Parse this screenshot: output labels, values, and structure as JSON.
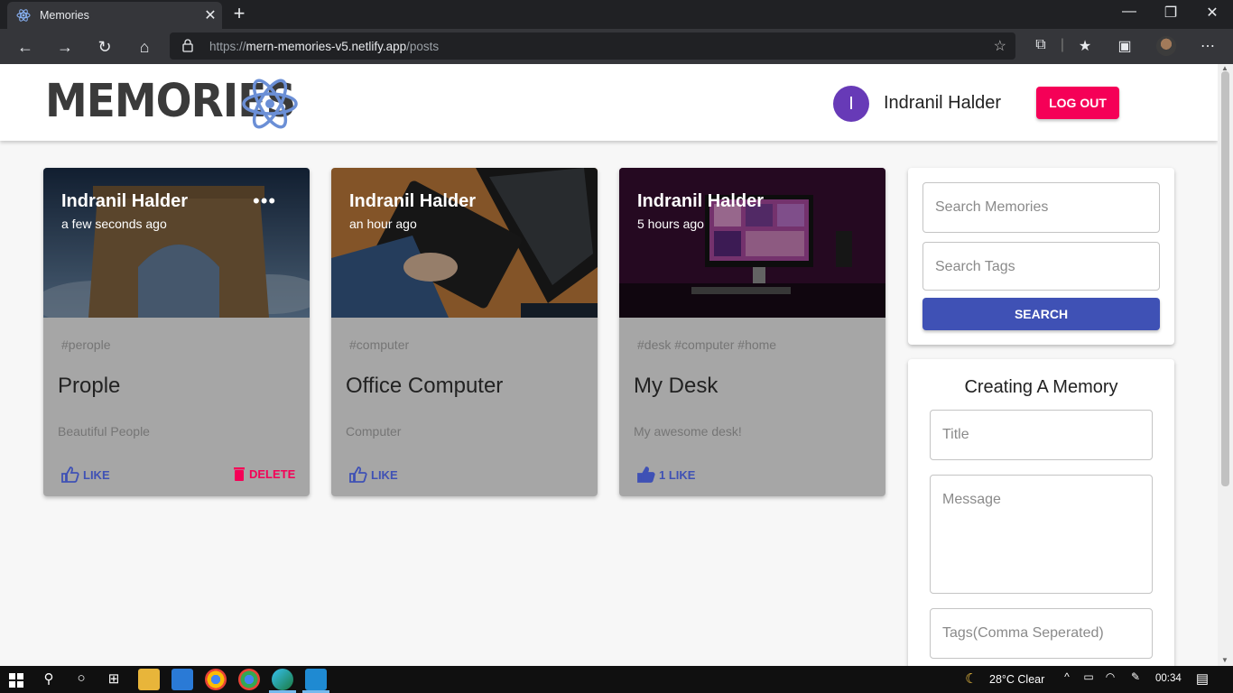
{
  "browser": {
    "tab_title": "Memories",
    "url_prefix": "https://",
    "url_host": "mern-memories-v5.netlify.app",
    "url_path": "/posts"
  },
  "app": {
    "logo_text": "MEMORIES",
    "user_initial": "I",
    "user_name": "Indranil Halder",
    "logout_label": "LOG OUT"
  },
  "posts": [
    {
      "author": "Indranil Halder",
      "time": "a few seconds ago",
      "tags": "#perople",
      "title": "Prople",
      "message": "Beautiful People",
      "like_label": "LIKE",
      "delete_label": "DELETE"
    },
    {
      "author": "Indranil Halder",
      "time": "an hour ago",
      "tags": "#computer",
      "title": "Office Computer",
      "message": "Computer",
      "like_label": "LIKE"
    },
    {
      "author": "Indranil Halder",
      "time": "5 hours ago",
      "tags": "#desk #computer #home",
      "title": "My Desk",
      "message": "My awesome desk!",
      "like_label": "1 LIKE"
    }
  ],
  "search": {
    "memories_placeholder": "Search Memories",
    "tags_placeholder": "Search Tags",
    "button_label": "SEARCH"
  },
  "form": {
    "title": "Creating A Memory",
    "title_placeholder": "Title",
    "message_placeholder": "Message",
    "tags_placeholder": "Tags(Comma Seperated)"
  },
  "taskbar": {
    "weather": "28°C  Clear",
    "time": "00:34"
  },
  "colors": {
    "primary": "#3f51b5",
    "secondary": "#f50057",
    "avatar": "#673ab7"
  }
}
